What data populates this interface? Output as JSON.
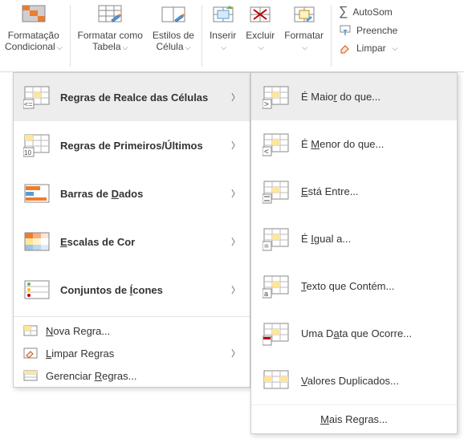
{
  "ribbon": {
    "cond_format_l1": "Formatação",
    "cond_format_l2": "Condicional",
    "table_l1": "Formatar como",
    "table_l2": "Tabela",
    "styles_l1": "Estilos de",
    "styles_l2": "Célula",
    "insert": "Inserir",
    "delete": "Excluir",
    "format": "Formatar",
    "autosum": "AutoSom",
    "fill": "Preenche",
    "clear": "Limpar"
  },
  "menu": {
    "highlight": "Regras de Realce das Células",
    "toprules": "Regras de Primeiros/Últimos",
    "databars": "Barras de Dados",
    "colorscales": "Escalas de Cor",
    "iconsets": "Conjuntos de Ícones",
    "newrule": "Nova Regra...",
    "clearrules": "Limpar Regras",
    "manage": "Gerenciar Regras..."
  },
  "submenu": {
    "greater": "É Maior do que...",
    "less": "É Menor do que...",
    "between": "Está Entre...",
    "equal": "É Igual a...",
    "text": "Texto que Contém...",
    "date": "Uma Data que Ocorre...",
    "dup": "Valores Duplicados...",
    "more": "Mais Regras..."
  }
}
